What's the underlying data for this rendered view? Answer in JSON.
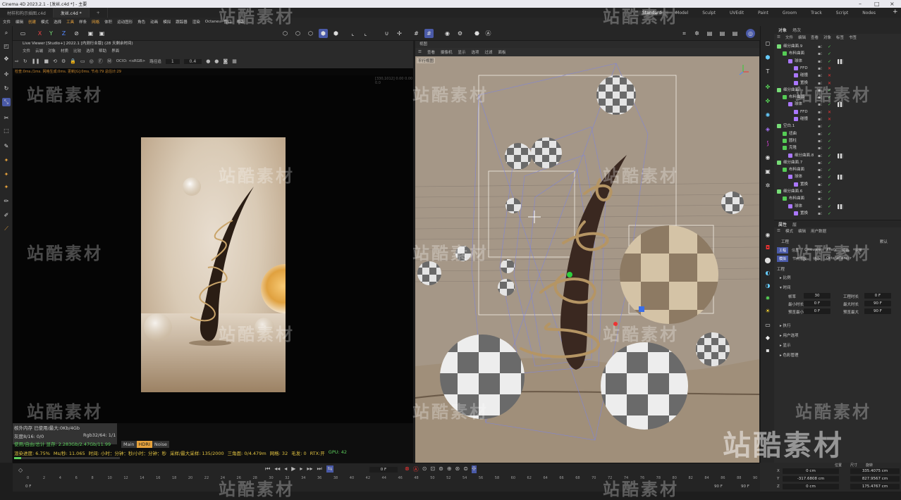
{
  "window": {
    "title": "Cinema 4D 2023.2.1 - [发丝.c4d *] - 主要"
  },
  "file_tabs": [
    {
      "label": "材样和构示插图.c4d"
    },
    {
      "label": "发丝.c4d *"
    }
  ],
  "add_tab": "+",
  "layouts": [
    "Standard",
    "Model",
    "Sculpt",
    "UVEdit",
    "Paint",
    "Groom",
    "Track",
    "Script",
    "Nodes"
  ],
  "layout_prefix": "启动",
  "main_menu": [
    "文件",
    "编辑",
    "创建",
    "模式",
    "选择",
    "工具",
    "样条",
    "网格",
    "体积",
    "运动图形",
    "角色",
    "动画",
    "模拟",
    "跟踪器",
    "渲染",
    "Octane",
    "窗口",
    "帮助"
  ],
  "live_viewer": {
    "title": "Live Viewer [Studio+] 2022.1 [内测行业版] (28 天剩余时间)",
    "menu": [
      "文件",
      "云端",
      "对象",
      "材质",
      "比较",
      "选项",
      "帮助",
      "界面"
    ],
    "ocio": "OCIO: <sRGB>",
    "mode": "路径追",
    "val1": "1",
    "val2": "0.4",
    "status": "检查:0ms./1ms. 网格生成:0ms. 更新[G]:0ms. 节点:79 总估计:29",
    "coord_readout": "[330,1012] 0.00 0.00 0.0"
  },
  "stats": {
    "mem": "核外内存 已使用/最大:0Kb/4Gb",
    "gray_label": "灰度8/16: 0/0",
    "rgb_label": "Rgb32/64: 1/1",
    "vram": "使用/自由/总计 显存: 2.283Gb/2.47Gb/11.99",
    "progress": "渲染进度: 6.75%",
    "ms": "Ms/秒: 11.065",
    "time": "时间: 小时：分钟：秒/小时：分钟：秒",
    "samples": "采样/最大采样: 135/2000",
    "tri": "三角面: 0/4.479m",
    "mesh": "网格: 32",
    "hair": "毛发: 0",
    "rtx": "RTX:开",
    "gpu": "GPU: 42",
    "tabs": [
      "Main",
      "HDRI",
      "Noise"
    ]
  },
  "viewport": {
    "title": "视图",
    "menu": [
      "查看",
      "摄像机",
      "显示",
      "选项",
      "过滤",
      "面板"
    ],
    "camera_label": "平行视图"
  },
  "object_manager": {
    "tabs": [
      "对象",
      "场次"
    ],
    "menu": [
      "文件",
      "编辑",
      "查看",
      "对象",
      "标签",
      "书签"
    ],
    "objects": [
      {
        "name": "细分曲面.9",
        "indent": 0
      },
      {
        "name": "布料曲面",
        "indent": 1
      },
      {
        "name": "球体",
        "indent": 2
      },
      {
        "name": "FFD",
        "indent": 3
      },
      {
        "name": "碰撞",
        "indent": 3
      },
      {
        "name": "置换",
        "indent": 3
      },
      {
        "name": "细分曲面",
        "indent": 0
      },
      {
        "name": "布料曲面",
        "indent": 1
      },
      {
        "name": "球体",
        "indent": 2
      },
      {
        "name": "FFD",
        "indent": 3
      },
      {
        "name": "碰撞",
        "indent": 3
      },
      {
        "name": "空白.1",
        "indent": 0
      },
      {
        "name": "扭曲",
        "indent": 1
      },
      {
        "name": "圆柱",
        "indent": 1
      },
      {
        "name": "克隆",
        "indent": 1
      },
      {
        "name": "细分曲面.8",
        "indent": 2
      },
      {
        "name": "细分曲面.7",
        "indent": 0
      },
      {
        "name": "布料曲面",
        "indent": 1
      },
      {
        "name": "球体",
        "indent": 2
      },
      {
        "name": "置换",
        "indent": 3
      },
      {
        "name": "细分曲面.6",
        "indent": 0
      },
      {
        "name": "布料曲面",
        "indent": 1
      },
      {
        "name": "球体",
        "indent": 2
      },
      {
        "name": "置换",
        "indent": 3
      }
    ]
  },
  "attributes": {
    "tabs": [
      "属性",
      "层"
    ],
    "menu": [
      "模式",
      "编辑",
      "用户数据"
    ],
    "section": "工程",
    "default_label": "默认",
    "subtabs": [
      "工程",
      "信息",
      "Cineware",
      "XRefs",
      "动画",
      "子弹"
    ],
    "subtabs2": [
      "模拟",
      "节点播放",
      "待办",
      "OctaneRender"
    ],
    "project_heading": "工程",
    "groups": [
      "比例",
      "时间",
      "执行",
      "用户选项",
      "显示",
      "色彩管理"
    ],
    "time_fields": [
      {
        "label": "帧率",
        "value": "30",
        "label2": "工程时长",
        "value2": "0 F"
      },
      {
        "label": "最小时长",
        "value": "0 F",
        "label2": "最大时长",
        "value2": "90 F"
      },
      {
        "label": "预览最小",
        "value": "0 F",
        "label2": "预览最大",
        "value2": "90 F"
      }
    ]
  },
  "timeline": {
    "current_frame": "0 F",
    "start": "0 F",
    "end": "90 F",
    "end2": "90 F",
    "ticks": [
      "0",
      "2",
      "4",
      "6",
      "8",
      "10",
      "12",
      "14",
      "16",
      "18",
      "20",
      "22",
      "24",
      "26",
      "28",
      "30",
      "32",
      "34",
      "36",
      "38",
      "40",
      "42",
      "44",
      "46",
      "48",
      "50",
      "52",
      "54",
      "56",
      "58",
      "60",
      "62",
      "64",
      "66",
      "68",
      "70",
      "72",
      "74",
      "76",
      "78",
      "80",
      "82",
      "84",
      "86",
      "88",
      "90"
    ]
  },
  "coords": {
    "header": [
      "位置",
      "尺寸",
      "旋转"
    ],
    "rows": [
      {
        "axis": "X",
        "pos": "0 cm",
        "size": "335.4075 cm"
      },
      {
        "axis": "Y",
        "pos": "-317.6808 cm",
        "size": "827.9567 cm"
      },
      {
        "axis": "Z",
        "pos": "0 cm",
        "size": "175.4767 cm"
      }
    ]
  },
  "watermark": "站酷素材",
  "colors": {
    "accent": "#4a5aa8",
    "orange": "#e6a23c",
    "green": "#5ccf5c",
    "red": "#d33"
  }
}
